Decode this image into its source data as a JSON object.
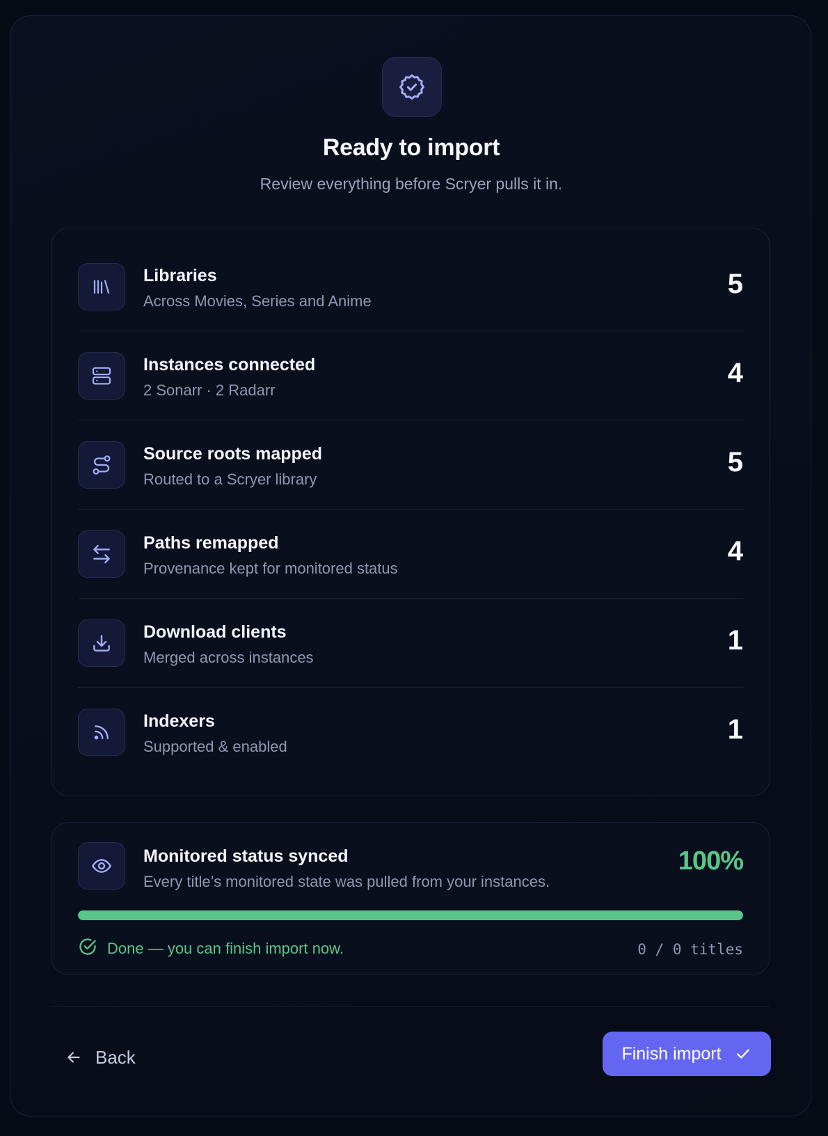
{
  "header": {
    "icon": "badge-check-icon",
    "title": "Ready to import",
    "subtitle": "Review everything before Scryer pulls it in."
  },
  "summary": {
    "items": [
      {
        "icon": "library-icon",
        "label": "Libraries",
        "description": "Across Movies, Series and Anime",
        "count": "5"
      },
      {
        "icon": "server-icon",
        "label": "Instances connected",
        "description": "2 Sonarr · 2 Radarr",
        "count": "4"
      },
      {
        "icon": "route-icon",
        "label": "Source roots mapped",
        "description": "Routed to a Scryer library",
        "count": "5"
      },
      {
        "icon": "arrows-swap-icon",
        "label": "Paths remapped",
        "description": "Provenance kept for monitored status",
        "count": "4"
      },
      {
        "icon": "download-icon",
        "label": "Download clients",
        "description": "Merged across instances",
        "count": "1"
      },
      {
        "icon": "rss-icon",
        "label": "Indexers",
        "description": "Supported & enabled",
        "count": "1"
      }
    ]
  },
  "sync": {
    "icon": "eye-icon",
    "label": "Monitored status synced",
    "description": "Every title’s monitored state was pulled from your instances.",
    "percent_text": "100%",
    "progress": 1.0,
    "done_text": "Done — you can finish import now.",
    "titles_text": "0 / 0 titles"
  },
  "footer": {
    "back_label": "Back",
    "finish_label": "Finish import"
  },
  "colors": {
    "accent": "#6366f1",
    "success": "#5ac588",
    "icon_tint": "#a5abf5"
  }
}
